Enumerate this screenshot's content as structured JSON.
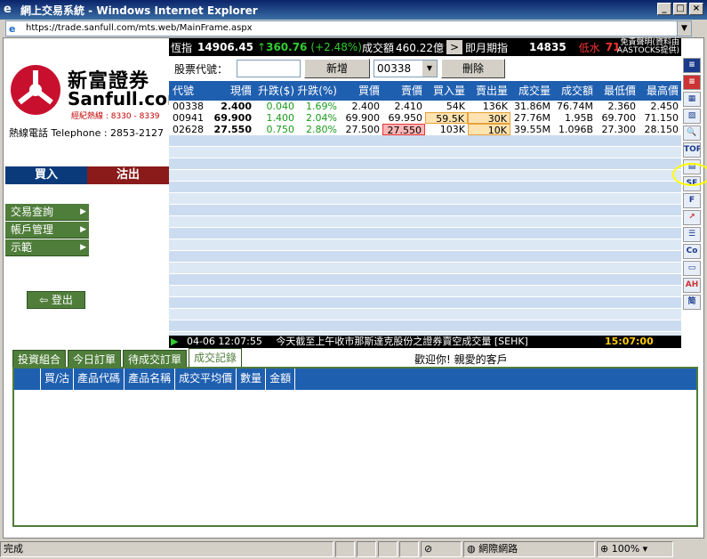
{
  "window": {
    "title": "網上交易系統 - Windows Internet Explorer"
  },
  "address": {
    "url": "https://trade.sanfull.com/mts.web/MainFrame.aspx"
  },
  "logo": {
    "cn": "新富證券",
    "en": "Sanfull.com",
    "hotline": "經紀熱線 : 8330 - 8339",
    "telephone": "熱線電話 Telephone : 2853-2127"
  },
  "actions": {
    "buy": "買入",
    "sell": "沽出",
    "logout": "登出"
  },
  "menu": [
    {
      "label": "交易查詢"
    },
    {
      "label": "帳戶管理"
    },
    {
      "label": "示範"
    }
  ],
  "ticker": {
    "hsi_label": "恆指",
    "hsi": "14906.45",
    "change": "360.76",
    "pct": "(+2.48%)",
    "turnover_label": "成交額",
    "turnover": "460.22億",
    "futures_label": "即月期指",
    "futures": "14835",
    "basis_label": "低水",
    "basis": "71",
    "disclaimer1": "免責聲明(資料由",
    "disclaimer2": "AASTOCKS提供)"
  },
  "input": {
    "stock_label": "股票代號：",
    "add": "新增",
    "selected": "00338",
    "delete": "刪除"
  },
  "grid": {
    "headers": [
      "代號",
      "現價",
      "升跌($)",
      "升跌(%)",
      "買價",
      "賣價",
      "買入量",
      "賣出量",
      "成交量",
      "成交額",
      "最低價",
      "最高價"
    ],
    "rows": [
      [
        "00338",
        "2.400",
        "0.040",
        "1.69%",
        "2.400",
        "2.410",
        "54K",
        "136K",
        "31.86M",
        "76.74M",
        "2.360",
        "2.450"
      ],
      [
        "00941",
        "69.900",
        "1.400",
        "2.04%",
        "69.900",
        "69.950",
        "59.5K",
        "30K",
        "27.76M",
        "1.95B",
        "69.700",
        "71.150"
      ],
      [
        "02628",
        "27.550",
        "0.750",
        "2.80%",
        "27.500",
        "27.550",
        "103K",
        "10K",
        "39.55M",
        "1.096B",
        "27.300",
        "28.150"
      ]
    ]
  },
  "news": {
    "time": "04-06 12:07:55",
    "text": "今天截至上午收市那斯達克股份之證券賣空成交量 [SEHK]",
    "clock": "15:07:00"
  },
  "tabs": [
    {
      "label": "投資組合"
    },
    {
      "label": "今日訂單"
    },
    {
      "label": "待成交訂單"
    },
    {
      "label": "成交記錄"
    }
  ],
  "welcome": "歡迎你! 親愛的客戶",
  "trade_headers": [
    "買/沽",
    "產品代碼",
    "產品名稱",
    "成交平均價",
    "數量",
    "金額"
  ],
  "statusbar": {
    "text": "完成",
    "zone": "網際網路",
    "zoom": "100%"
  }
}
